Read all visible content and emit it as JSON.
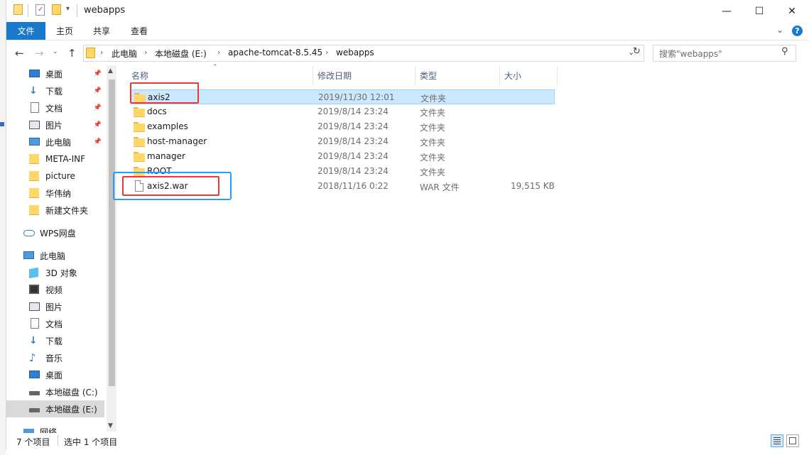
{
  "window": {
    "title": "webapps"
  },
  "window_controls": {
    "minimize": "—",
    "maximize": "☐",
    "close": "✕"
  },
  "ribbon": {
    "tabs": [
      "文件",
      "主页",
      "共享",
      "查看"
    ],
    "expand": "⌄",
    "help": "?"
  },
  "address": {
    "breadcrumb": [
      "此电脑",
      "本地磁盘 (E:)",
      "apache-tomcat-8.5.45",
      "webapps"
    ],
    "search_placeholder": "搜索\"webapps\""
  },
  "nav_pane": {
    "quick_access": [
      {
        "label": "桌面",
        "icon": "desktop-icon",
        "pinned": true
      },
      {
        "label": "下载",
        "icon": "download-icon",
        "pinned": true
      },
      {
        "label": "文档",
        "icon": "document-icon",
        "pinned": true
      },
      {
        "label": "图片",
        "icon": "pictures-icon",
        "pinned": true
      },
      {
        "label": "此电脑",
        "icon": "computer-icon",
        "pinned": true
      },
      {
        "label": "META-INF",
        "icon": "folder-icon",
        "pinned": false
      },
      {
        "label": "picture",
        "icon": "folder-icon",
        "pinned": false
      },
      {
        "label": "华伟纳",
        "icon": "folder-icon",
        "pinned": false
      },
      {
        "label": "新建文件夹",
        "icon": "folder-icon",
        "pinned": false
      }
    ],
    "wps": "WPS网盘",
    "this_pc": "此电脑",
    "this_pc_items": [
      {
        "label": "3D 对象",
        "icon": "3d-objects-icon"
      },
      {
        "label": "视频",
        "icon": "videos-icon"
      },
      {
        "label": "图片",
        "icon": "pictures-icon"
      },
      {
        "label": "文档",
        "icon": "document-icon"
      },
      {
        "label": "下载",
        "icon": "download-icon"
      },
      {
        "label": "音乐",
        "icon": "music-icon"
      },
      {
        "label": "桌面",
        "icon": "desktop-icon"
      },
      {
        "label": "本地磁盘 (C:)",
        "icon": "drive-icon"
      },
      {
        "label": "本地磁盘 (E:)",
        "icon": "drive-icon"
      }
    ],
    "network": "网络"
  },
  "columns": {
    "name": "名称",
    "date": "修改日期",
    "type": "类型",
    "size": "大小"
  },
  "files": [
    {
      "name": "axis2",
      "date": "2019/11/30 12:01",
      "type": "文件夹",
      "size": "",
      "kind": "folder",
      "selected": true
    },
    {
      "name": "docs",
      "date": "2019/8/14 23:24",
      "type": "文件夹",
      "size": "",
      "kind": "folder",
      "selected": false
    },
    {
      "name": "examples",
      "date": "2019/8/14 23:24",
      "type": "文件夹",
      "size": "",
      "kind": "folder",
      "selected": false
    },
    {
      "name": "host-manager",
      "date": "2019/8/14 23:24",
      "type": "文件夹",
      "size": "",
      "kind": "folder",
      "selected": false
    },
    {
      "name": "manager",
      "date": "2019/8/14 23:24",
      "type": "文件夹",
      "size": "",
      "kind": "folder",
      "selected": false
    },
    {
      "name": "ROOT",
      "date": "2019/8/14 23:24",
      "type": "文件夹",
      "size": "",
      "kind": "folder",
      "selected": false
    },
    {
      "name": "axis2.war",
      "date": "2018/11/16 0:22",
      "type": "WAR 文件",
      "size": "19,515 KB",
      "kind": "file",
      "selected": false
    }
  ],
  "status": {
    "count": "7 个项目",
    "selection": "选中 1 个项目"
  },
  "colors": {
    "accent": "#1979ca",
    "selection_bg": "#cce8ff",
    "annotation_red": "#e53935",
    "annotation_blue": "#2a9df4"
  }
}
